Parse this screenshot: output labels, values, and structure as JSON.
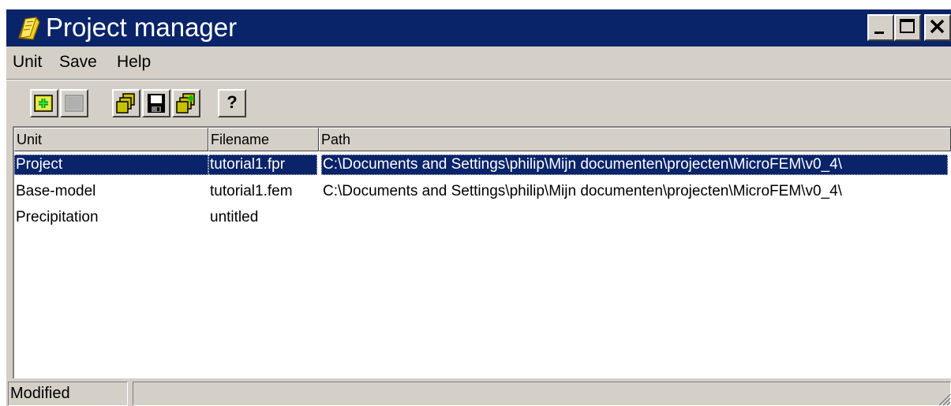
{
  "window": {
    "title": "Project manager",
    "icon": "yellow-folder-icon",
    "controls": [
      "minimize-icon",
      "maximize-icon",
      "close-icon"
    ]
  },
  "menu": {
    "items": [
      {
        "label": "Unit"
      },
      {
        "label": "Save"
      },
      {
        "label": "Help"
      }
    ]
  },
  "toolbar": {
    "buttons": [
      {
        "icon": "add-unit-icon",
        "enabled": true
      },
      {
        "icon": "remove-unit-icon",
        "enabled": false
      },
      {
        "icon": "open-all-icon",
        "enabled": true
      },
      {
        "icon": "save-icon",
        "enabled": true
      },
      {
        "icon": "save-all-icon",
        "enabled": true
      },
      {
        "icon": "help-icon",
        "label": "?",
        "enabled": true
      }
    ]
  },
  "list": {
    "columns": [
      "Unit",
      "Filename",
      "Path"
    ],
    "rows": [
      {
        "unit": "Project",
        "filename": "tutorial1.fpr",
        "path": "C:\\Documents and Settings\\philip\\Mijn documenten\\projecten\\MicroFEM\\v0_4\\",
        "selected": true
      },
      {
        "unit": "Base-model",
        "filename": "tutorial1.fem",
        "path": "C:\\Documents and Settings\\philip\\Mijn documenten\\projecten\\MicroFEM\\v0_4\\",
        "selected": false
      },
      {
        "unit": "Precipitation",
        "filename": "untitled",
        "path": "",
        "selected": false
      }
    ]
  },
  "status": {
    "text": "Modified"
  },
  "colors": {
    "titlebar": "#0a246a",
    "selection": "#0a246a",
    "face": "#d4d0c8"
  }
}
